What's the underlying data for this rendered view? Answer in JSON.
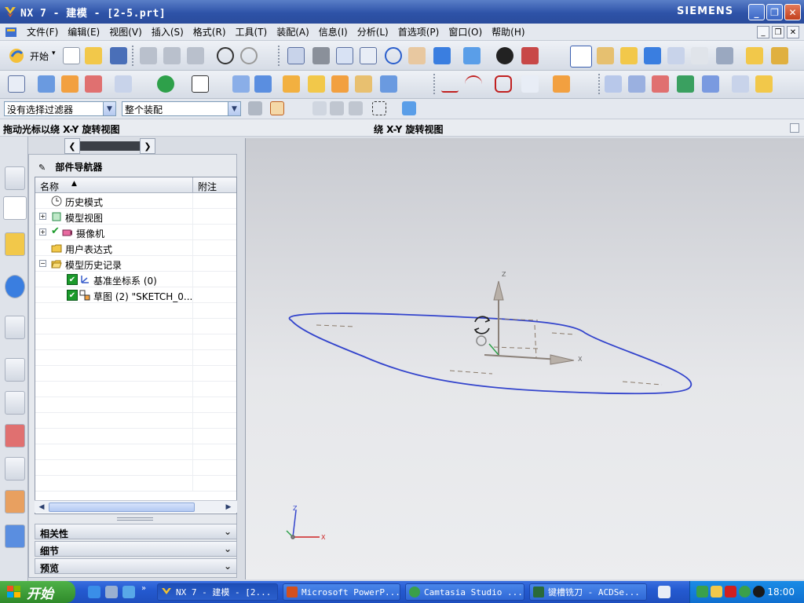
{
  "window": {
    "title": "NX 7 - 建模 - [2-5.prt]",
    "brand": "SIEMENS",
    "icons": [
      "nx-logo-icon",
      "minimize-icon",
      "restore-icon",
      "close-icon"
    ]
  },
  "menubar": {
    "items": [
      "文件(F)",
      "编辑(E)",
      "视图(V)",
      "插入(S)",
      "格式(R)",
      "工具(T)",
      "装配(A)",
      "信息(I)",
      "分析(L)",
      "首选项(P)",
      "窗口(O)",
      "帮助(H)"
    ]
  },
  "toolbar": {
    "start_label": "开始",
    "start_arrow": "▾"
  },
  "selection_bar": {
    "filter_value": "没有选择过滤器",
    "scope_value": "整个装配"
  },
  "status": {
    "prompt": "拖动光标以绕 X-Y 旋转视图",
    "status_text": "绕 X-Y 旋转视图"
  },
  "navigator": {
    "title": "部件导航器",
    "col_name": "名称",
    "col_note": "附注",
    "rows": [
      {
        "label": "历史模式",
        "icon": "clock-icon"
      },
      {
        "label": "模型视图",
        "icon": "model-view-icon"
      },
      {
        "label": "摄像机",
        "icon": "camera-icon"
      },
      {
        "label": "用户表达式",
        "icon": "folder-icon"
      },
      {
        "label": "模型历史记录",
        "icon": "folder-open-icon"
      },
      {
        "label": "基准坐标系 (0)",
        "icon": "datum-csys-icon"
      },
      {
        "label": "草图 (2) \"SKETCH_0...",
        "icon": "sketch-icon"
      }
    ],
    "sections": [
      "相关性",
      "细节",
      "预览"
    ]
  },
  "graphics": {
    "axis_labels": {
      "z": "Z",
      "x": "X"
    },
    "triad_labels": {
      "z": "Z",
      "x": "X"
    },
    "sketch_color": "#3344cc"
  },
  "taskbar": {
    "start_label": "开始",
    "tasks": [
      "NX 7 - 建模 - [2...",
      "Microsoft PowerP...",
      "Camtasia Studio ...",
      "键槽铣刀 - ACDSe..."
    ],
    "clock": "18:00"
  }
}
